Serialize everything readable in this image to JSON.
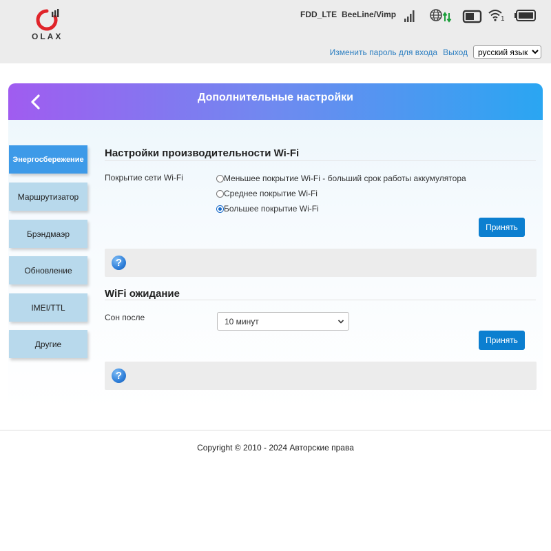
{
  "header": {
    "logo_text": "OLAX",
    "network_type": "FDD_LTE",
    "operator": "BeeLine/Vimp",
    "wifi_clients": "1",
    "change_password_link": "Изменить пароль для входа",
    "logout_link": "Выход",
    "language": "русский язык"
  },
  "banner": {
    "title": "Дополнительные настройки"
  },
  "sidebar": {
    "items": [
      {
        "label": "Энергосбережение",
        "active": true
      },
      {
        "label": "Маршрутизатор",
        "active": false
      },
      {
        "label": "Брэндмаэр",
        "active": false
      },
      {
        "label": "Обновление",
        "active": false
      },
      {
        "label": "IMEI/TTL",
        "active": false
      },
      {
        "label": "Другие",
        "active": false
      }
    ]
  },
  "wifi_performance": {
    "title": "Настройки производительности Wi-Fi",
    "coverage_label": "Покрытие сети Wi-Fi",
    "options": [
      {
        "label": "Меньшее покрытие Wi-Fi - больший срок работы аккумулятора",
        "checked": false
      },
      {
        "label": "Среднее покрытие Wi-Fi",
        "checked": false
      },
      {
        "label": "Большее покрытие Wi-Fi",
        "checked": true
      }
    ],
    "apply_label": "Принять"
  },
  "wifi_sleep": {
    "title": "WiFi ожидание",
    "sleep_label": "Сон после",
    "sleep_value": "10 минут",
    "apply_label": "Принять"
  },
  "help_icon_glyph": "?",
  "footer": {
    "copyright": "Copyright © 2010 - 2024 Авторские права"
  },
  "colors": {
    "accent": "#0c7fd0",
    "sidebar_active": "#3d9ae8",
    "sidebar_item": "#b8d9ec",
    "link": "#2d7fc1",
    "logo_red": "#e0242a"
  }
}
